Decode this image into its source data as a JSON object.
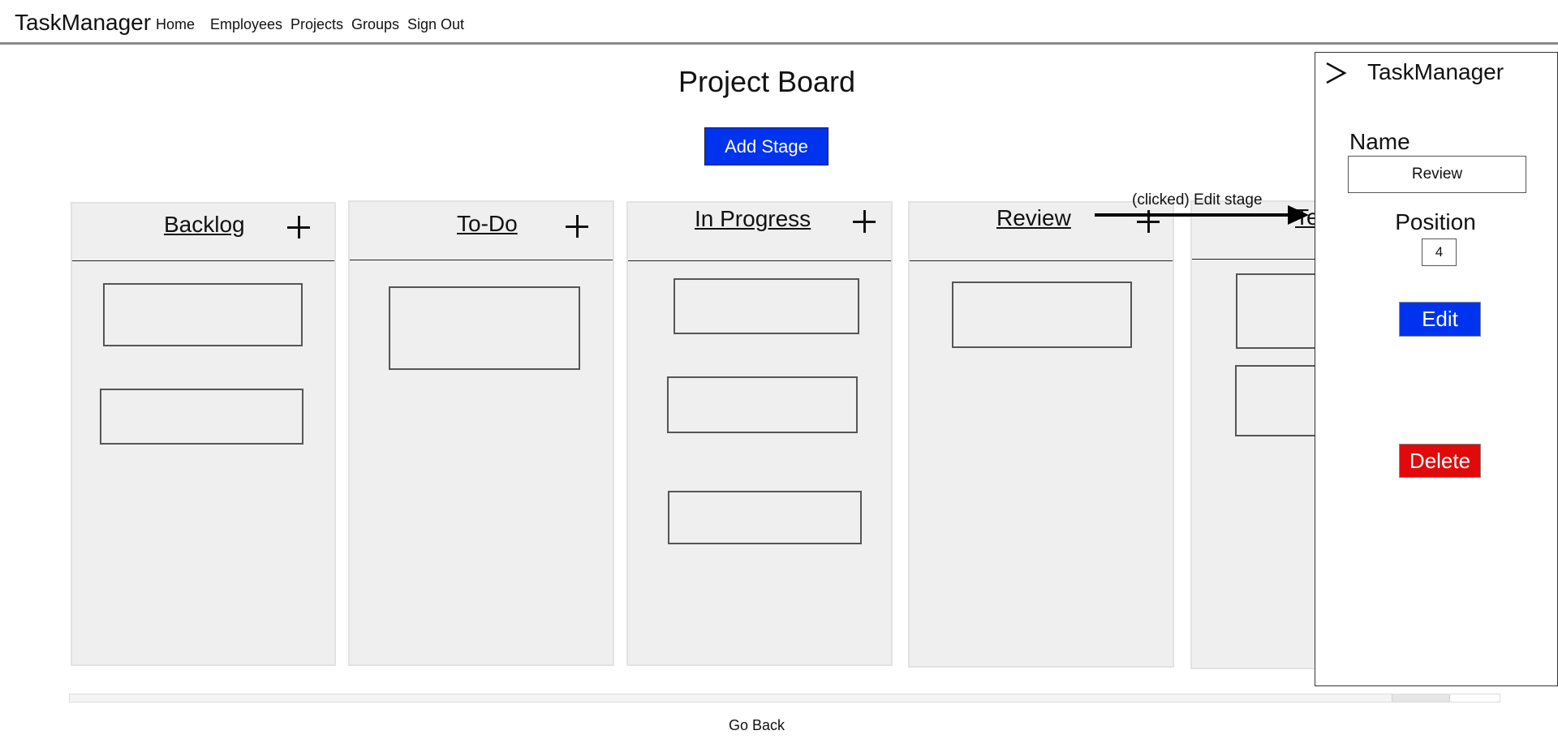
{
  "nav": {
    "brand": "TaskManager",
    "links": [
      "Home",
      "Employees",
      "Projects",
      "Groups",
      "Sign Out"
    ]
  },
  "page": {
    "title": "Project Board",
    "add_stage_label": "Add Stage",
    "go_back_label": "Go Back"
  },
  "board": {
    "stages": [
      {
        "title": "Backlog",
        "task_count": 2
      },
      {
        "title": "To-Do",
        "task_count": 1
      },
      {
        "title": "In Progress",
        "task_count": 3
      },
      {
        "title": "Review",
        "task_count": 1
      },
      {
        "title": "Te",
        "task_count": 2
      }
    ]
  },
  "annotation": {
    "text": "(clicked) Edit stage"
  },
  "side_panel": {
    "title": "TaskManager",
    "name_label": "Name",
    "name_value": "Review",
    "position_label": "Position",
    "position_value": "4",
    "edit_label": "Edit",
    "delete_label": "Delete"
  },
  "colors": {
    "primary_button": "#0033ee",
    "danger_button": "#e00a0a",
    "stage_background": "#efefef"
  },
  "icons": {
    "add_task": "plus-icon",
    "panel_toggle": "chevron-right-icon"
  }
}
